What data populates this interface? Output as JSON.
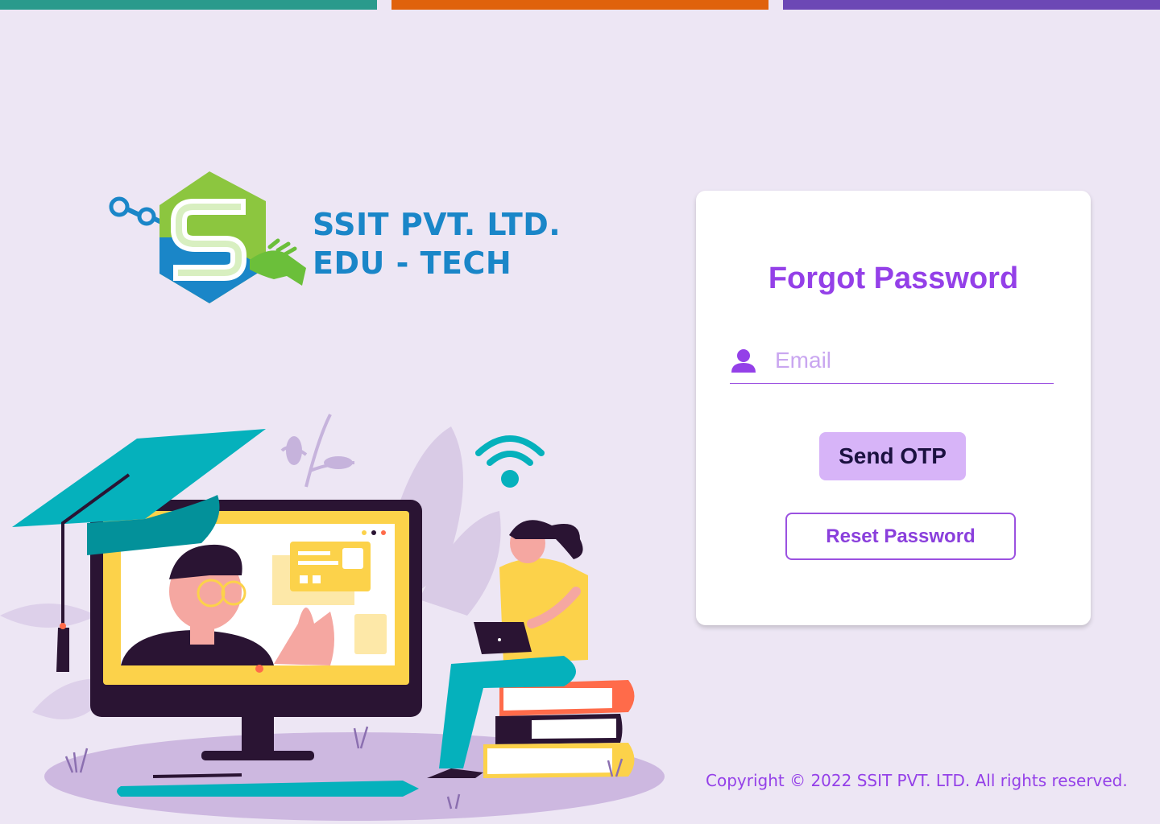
{
  "brand": {
    "line1": "SSIT PVT. LTD.",
    "line2": "EDU - TECH",
    "colors": {
      "green": "#8cc63f",
      "blue": "#1a86c8"
    }
  },
  "accent_bars": [
    "#2a9a8c",
    "#e0620c",
    "#6c48b5"
  ],
  "form": {
    "title": "Forgot Password",
    "email_placeholder": "Email",
    "email_icon": "user-icon",
    "send_otp_label": "Send OTP",
    "reset_label": "Reset Password",
    "accent": "#9440e8"
  },
  "footer": {
    "copyright": "Copyright © 2022 SSIT PVT. LTD. All rights reserved."
  }
}
